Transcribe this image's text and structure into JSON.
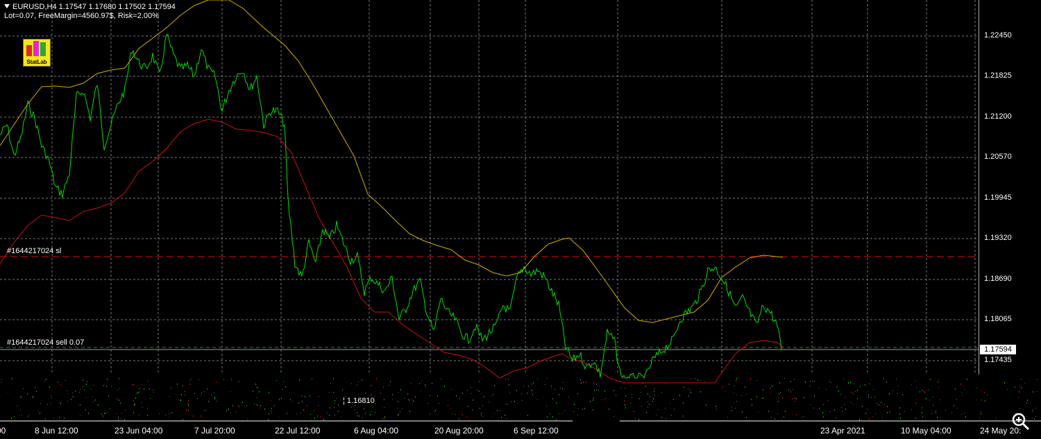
{
  "header": {
    "symbol_line": "EURUSD,H4  1.17547 1.17680 1.17502 1.17594",
    "info_line": "Lot=0.07, FreeMargin=4560.97$, Risk=2.00%"
  },
  "logo": {
    "text": "StatLab"
  },
  "price_axis": [
    "1.22450",
    "1.21825",
    "1.21200",
    "1.20570",
    "1.19945",
    "1.19320",
    "1.18690",
    "1.18065",
    "1.17435"
  ],
  "current_price": "1.17594",
  "levels": {
    "sl_label": "#1644217024 sl",
    "sell_label": "#1644217024 sell 0.07"
  },
  "crosshair_price": "1.16810",
  "time_axis": [
    "00",
    "8 Jun 12:00",
    "23 Jun 04:00",
    "7 Jul 20:00",
    "22 Jul 12:00",
    "6 Aug 04:00",
    "20 Aug 20:00",
    "6 Sep 12:00",
    "23 Apr 2021",
    "10 May 04:00",
    "24 May 20:"
  ],
  "colors": {
    "price_line": "#00e000",
    "upper_band": "#d4b000",
    "lower_band": "#d01010",
    "grid": "#7a7a7a",
    "sl_line": "#d01010",
    "sell_line": "#2a8a2a"
  },
  "icons": {
    "zoom": "magnifier-zoom-icon"
  }
}
